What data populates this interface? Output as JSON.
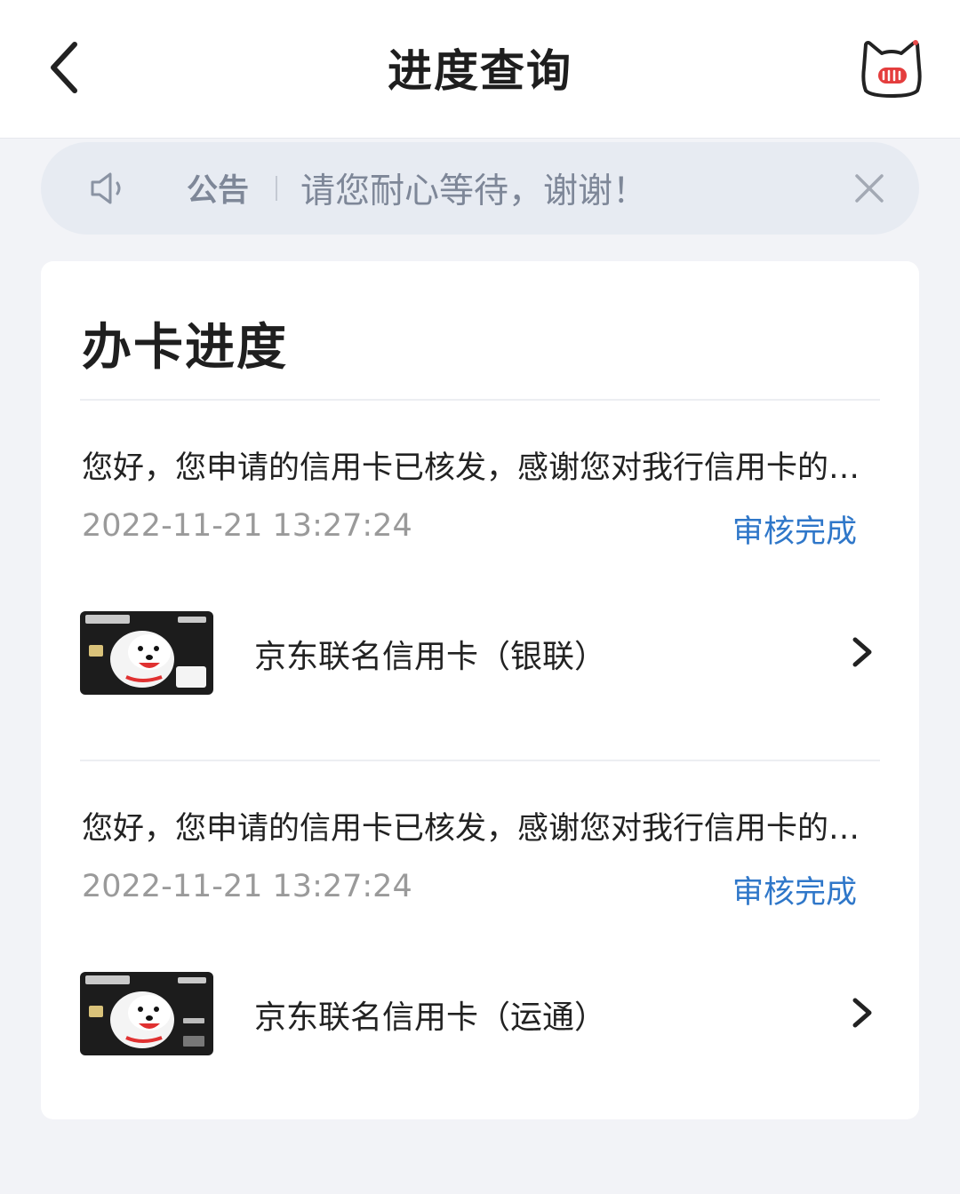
{
  "header": {
    "title": "进度查询"
  },
  "notice": {
    "label": "公告",
    "text": "请您耐心等待，谢谢！"
  },
  "section": {
    "title": "办卡进度"
  },
  "applications": [
    {
      "message": "您好，您申请的信用卡已核发，感谢您对我行信用卡的支持！",
      "time": "2022-11-21 13:27:24",
      "status": "审核完成",
      "card_name": "京东联名信用卡（银联）"
    },
    {
      "message": "您好，您申请的信用卡已核发，感谢您对我行信用卡的支持！",
      "time": "2022-11-21 13:27:24",
      "status": "审核完成",
      "card_name": "京东联名信用卡（运通）"
    }
  ],
  "colors": {
    "status": "#2f77c9",
    "notice_bg": "#e7ebf2",
    "page_bg": "#f2f3f7"
  }
}
